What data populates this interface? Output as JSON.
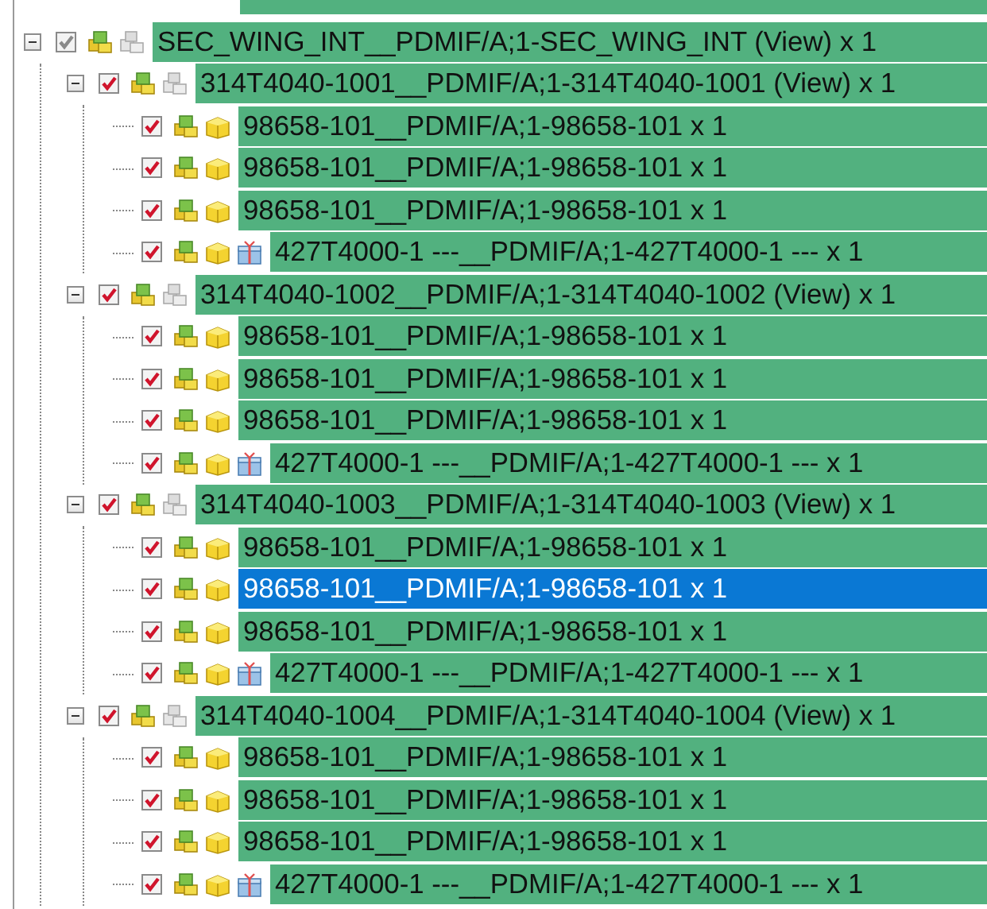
{
  "tree": [
    {
      "label": "SEC_WING_INT__PDMIF/A;1-SEC_WING_INT (View) x 1",
      "kind": "assembly",
      "checked": true,
      "dimmed": true,
      "expanded": true,
      "selected": false,
      "children": [
        {
          "label": "314T4040-1001__PDMIF/A;1-314T4040-1001 (View) x 1",
          "kind": "assembly",
          "checked": true,
          "expanded": true,
          "selected": false,
          "children": [
            {
              "label": "98658-101__PDMIF/A;1-98658-101 x 1",
              "kind": "part",
              "checked": true,
              "selected": false
            },
            {
              "label": "98658-101__PDMIF/A;1-98658-101 x 1",
              "kind": "part",
              "checked": true,
              "selected": false
            },
            {
              "label": "98658-101__PDMIF/A;1-98658-101 x 1",
              "kind": "part",
              "checked": true,
              "selected": false
            },
            {
              "label": "427T4000-1 ---__PDMIF/A;1-427T4000-1 --- x 1",
              "kind": "package",
              "checked": true,
              "selected": false
            }
          ]
        },
        {
          "label": "314T4040-1002__PDMIF/A;1-314T4040-1002 (View) x 1",
          "kind": "assembly",
          "checked": true,
          "expanded": true,
          "selected": false,
          "children": [
            {
              "label": "98658-101__PDMIF/A;1-98658-101 x 1",
              "kind": "part",
              "checked": true,
              "selected": false
            },
            {
              "label": "98658-101__PDMIF/A;1-98658-101 x 1",
              "kind": "part",
              "checked": true,
              "selected": false
            },
            {
              "label": "98658-101__PDMIF/A;1-98658-101 x 1",
              "kind": "part",
              "checked": true,
              "selected": false
            },
            {
              "label": "427T4000-1 ---__PDMIF/A;1-427T4000-1 --- x 1",
              "kind": "package",
              "checked": true,
              "selected": false
            }
          ]
        },
        {
          "label": "314T4040-1003__PDMIF/A;1-314T4040-1003 (View) x 1",
          "kind": "assembly",
          "checked": true,
          "expanded": true,
          "selected": false,
          "children": [
            {
              "label": "98658-101__PDMIF/A;1-98658-101 x 1",
              "kind": "part",
              "checked": true,
              "selected": false
            },
            {
              "label": "98658-101__PDMIF/A;1-98658-101 x 1",
              "kind": "part",
              "checked": true,
              "selected": true
            },
            {
              "label": "98658-101__PDMIF/A;1-98658-101 x 1",
              "kind": "part",
              "checked": true,
              "selected": false
            },
            {
              "label": "427T4000-1 ---__PDMIF/A;1-427T4000-1 --- x 1",
              "kind": "package",
              "checked": true,
              "selected": false
            }
          ]
        },
        {
          "label": "314T4040-1004__PDMIF/A;1-314T4040-1004 (View) x 1",
          "kind": "assembly",
          "checked": true,
          "expanded": true,
          "selected": false,
          "children": [
            {
              "label": "98658-101__PDMIF/A;1-98658-101 x 1",
              "kind": "part",
              "checked": true,
              "selected": false
            },
            {
              "label": "98658-101__PDMIF/A;1-98658-101 x 1",
              "kind": "part",
              "checked": true,
              "selected": false
            },
            {
              "label": "98658-101__PDMIF/A;1-98658-101 x 1",
              "kind": "part",
              "checked": true,
              "selected": false
            },
            {
              "label": "427T4000-1 ---__PDMIF/A;1-427T4000-1 --- x 1",
              "kind": "package",
              "checked": true,
              "selected": false
            }
          ]
        }
      ]
    }
  ]
}
